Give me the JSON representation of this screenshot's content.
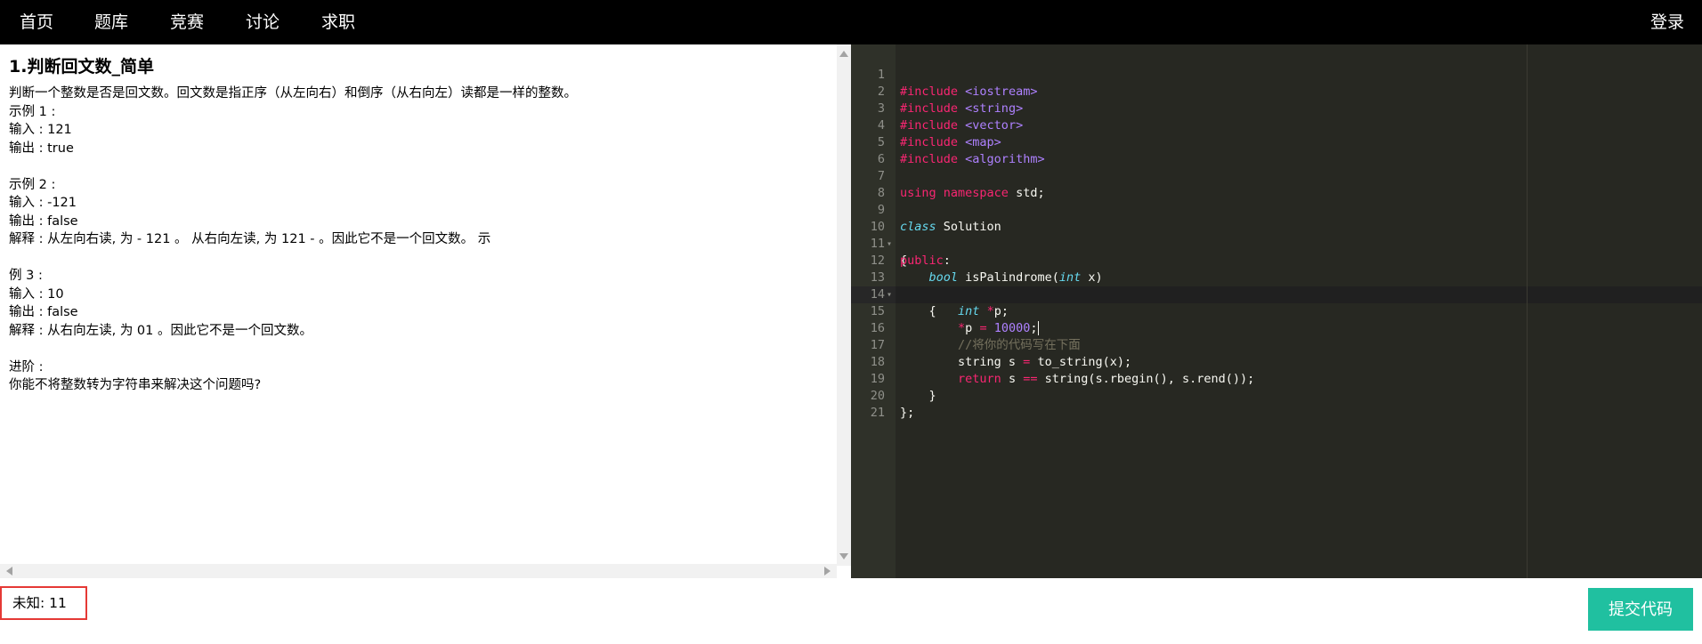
{
  "nav": {
    "items": [
      "首页",
      "题库",
      "竞赛",
      "讨论",
      "求职"
    ],
    "login": "登录"
  },
  "problem": {
    "title": "1.判断回文数_简单",
    "body": "判断一个整数是否是回文数。回文数是指正序（从左向右）和倒序（从右向左）读都是一样的整数。\n示例 1 :\n输入 : 121\n输出 : true\n\n示例 2 :\n输入 : -121\n输出 : false\n解释 : 从左向右读, 为 - 121 。 从右向左读, 为 121 - 。因此它不是一个回文数。 示\n\n例 3 :\n输入 : 10\n输出 : false\n解释 : 从右向左读, 为 01 。因此它不是一个回文数。\n\n进阶 :\n你能不将整数转为字符串来解决这个问题吗?"
  },
  "editor": {
    "line_numbers": [
      "1",
      "2",
      "3",
      "4",
      "5",
      "6",
      "7",
      "8",
      "9",
      "10",
      "11",
      "12",
      "13",
      "14",
      "15",
      "16",
      "17",
      "18",
      "19",
      "20",
      "21"
    ],
    "fold_lines": [
      "10",
      "13"
    ],
    "active_line": "15",
    "code": {
      "l1_kw": "#include",
      "l1_lib": "<iostream>",
      "l2_kw": "#include",
      "l2_lib": "<string>",
      "l3_kw": "#include",
      "l3_lib": "<vector>",
      "l4_kw": "#include",
      "l4_lib": "<map>",
      "l5_kw": "#include",
      "l5_lib": "<algorithm>",
      "l7_kw1": "using",
      "l7_kw2": "namespace",
      "l7_rest": "std;",
      "l9_kw": "class",
      "l9_rest": "Solution",
      "l10": "{",
      "l11_kw": "public",
      "l11_rest": ":",
      "l12_indent": "    ",
      "l12_type": "bool",
      "l12_name": "isPalindrome",
      "l12_open": "(",
      "l12_ptype": "int",
      "l12_rest": " x)",
      "l13": "    {",
      "l14_indent": "        ",
      "l14_type": "int",
      "l14_op": "*",
      "l14_rest": "p;",
      "l15_indent": "        ",
      "l15_op": "*",
      "l15_mid": "p ",
      "l15_eq": "=",
      "l15_num": "10000",
      "l15_end": ";",
      "l16_indent": "        ",
      "l16_cmt": "//将你的代码写在下面",
      "l17": "        string s = to_string(x);",
      "l17_pre": "        string s ",
      "l17_eq": "=",
      "l17_post": " to_string(x);",
      "l18_indent": "        ",
      "l18_kw": "return",
      "l18_mid": " s ",
      "l18_eq": "==",
      "l18_post": " string(s.rbegin(), s.rend());",
      "l19": "    }",
      "l20": "};"
    }
  },
  "status": {
    "text": "未知: 11"
  },
  "submit": {
    "label": "提交代码"
  },
  "colors": {
    "accent": "#20c0a0",
    "status_border": "#e53935",
    "editor_bg": "#272822"
  }
}
